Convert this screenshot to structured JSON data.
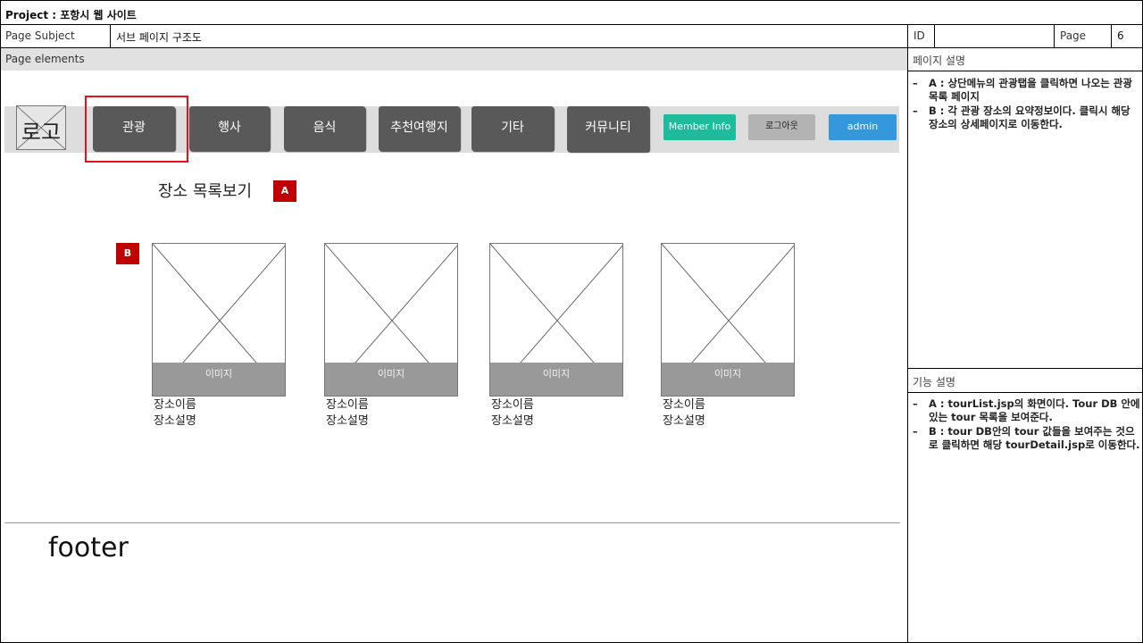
{
  "header": {
    "project_title": "Project : 포항시 웹 사이트",
    "page_subject_label": "Page Subject",
    "page_subject_value": "서브 페이지 구조도",
    "id_label": "ID",
    "id_value": "",
    "page_label": "Page",
    "page_value": "6"
  },
  "page_elements_label": "Page elements",
  "nav": {
    "logo_text": "로고",
    "items": [
      "관광",
      "행사",
      "음식",
      "추천여행지",
      "기타",
      "커뮤니티"
    ],
    "member_info": "Member Info",
    "logout": "로그아웃",
    "admin": "admin",
    "selected_item": "관광",
    "colors": {
      "nav_button": "#595959",
      "member": "#1ebc9c",
      "logout": "#b3b3b3",
      "admin": "#3498db",
      "highlight": "#e0141e"
    }
  },
  "main": {
    "section_title": "장소 목록보기",
    "tag_a": "A",
    "tag_b": "B",
    "cards": [
      {
        "image_label": "이미지",
        "name": "장소이름",
        "desc": "장소설명"
      },
      {
        "image_label": "이미지",
        "name": "장소이름",
        "desc": "장소설명"
      },
      {
        "image_label": "이미지",
        "name": "장소이름",
        "desc": "장소설명"
      },
      {
        "image_label": "이미지",
        "name": "장소이름",
        "desc": "장소설명"
      }
    ]
  },
  "footer": {
    "text": "footer"
  },
  "sidebar": {
    "page_desc_title": "페이지 설명",
    "page_desc": [
      "A : 상단메뉴의 관광탭을 클릭하면 나오는 관광 목록 페이지",
      "B : 각 관광 장소의 요약정보이다. 클릭시 해당 장소의 상세페이지로 이동한다."
    ],
    "func_desc_title": "기능 설명",
    "func_desc": [
      "A : tourList.jsp의 화면이다. Tour DB 안에 있는 tour 목록을 보여준다.",
      "B : tour DB안의 tour 값들을 보여주는 것으로 클릭하면 해당 tourDetail.jsp로 이동한다."
    ],
    "dash": "–"
  }
}
